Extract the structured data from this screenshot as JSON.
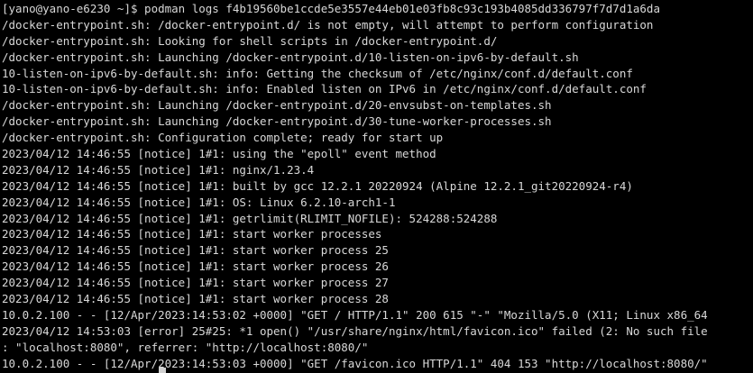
{
  "terminal": {
    "background": "#000000",
    "foreground": "#d8d8d8",
    "lines": [
      "[yano@yano-e6230 ~]$ podman logs f4b19560be1ccde5e3557e44eb01e03fb8c93c193b4085dd336797f7d7d1a6da",
      "/docker-entrypoint.sh: /docker-entrypoint.d/ is not empty, will attempt to perform configuration",
      "/docker-entrypoint.sh: Looking for shell scripts in /docker-entrypoint.d/",
      "/docker-entrypoint.sh: Launching /docker-entrypoint.d/10-listen-on-ipv6-by-default.sh",
      "10-listen-on-ipv6-by-default.sh: info: Getting the checksum of /etc/nginx/conf.d/default.conf",
      "10-listen-on-ipv6-by-default.sh: info: Enabled listen on IPv6 in /etc/nginx/conf.d/default.conf",
      "/docker-entrypoint.sh: Launching /docker-entrypoint.d/20-envsubst-on-templates.sh",
      "/docker-entrypoint.sh: Launching /docker-entrypoint.d/30-tune-worker-processes.sh",
      "/docker-entrypoint.sh: Configuration complete; ready for start up",
      "2023/04/12 14:46:55 [notice] 1#1: using the \"epoll\" event method",
      "2023/04/12 14:46:55 [notice] 1#1: nginx/1.23.4",
      "2023/04/12 14:46:55 [notice] 1#1: built by gcc 12.2.1 20220924 (Alpine 12.2.1_git20220924-r4)",
      "2023/04/12 14:46:55 [notice] 1#1: OS: Linux 6.2.10-arch1-1",
      "2023/04/12 14:46:55 [notice] 1#1: getrlimit(RLIMIT_NOFILE): 524288:524288",
      "2023/04/12 14:46:55 [notice] 1#1: start worker processes",
      "2023/04/12 14:46:55 [notice] 1#1: start worker process 25",
      "2023/04/12 14:46:55 [notice] 1#1: start worker process 26",
      "2023/04/12 14:46:55 [notice] 1#1: start worker process 27",
      "2023/04/12 14:46:55 [notice] 1#1: start worker process 28",
      "10.0.2.100 - - [12/Apr/2023:14:53:02 +0000] \"GET / HTTP/1.1\" 200 615 \"-\" \"Mozilla/5.0 (X11; Linux x86_64",
      "2023/04/12 14:53:03 [error] 25#25: *1 open() \"/usr/share/nginx/html/favicon.ico\" failed (2: No such file",
      ": \"localhost:8080\", referrer: \"http://localhost:8080/\"",
      "10.0.2.100 - - [12/Apr/2023:14:53:03 +0000] \"GET /favicon.ico HTTP/1.1\" 404 153 \"http://localhost:8080/\""
    ]
  }
}
